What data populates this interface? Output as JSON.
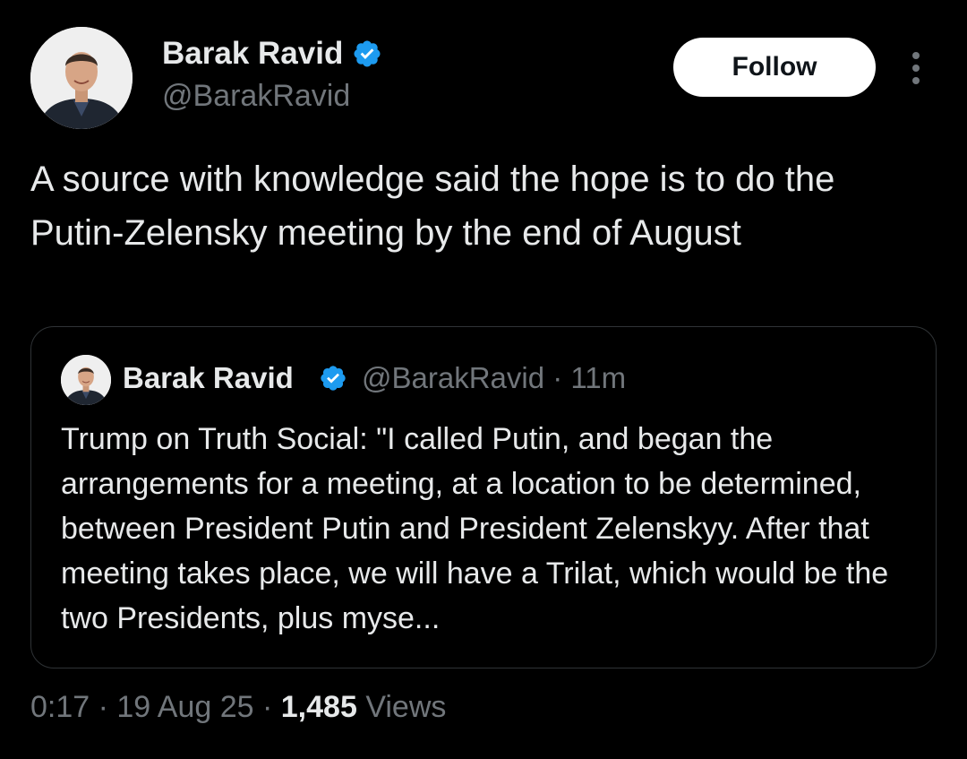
{
  "author": {
    "display_name": "Barak Ravid",
    "handle": "@BarakRavid",
    "verified_icon": "verified-badge-icon",
    "verified_color": "#1d9bf0"
  },
  "actions": {
    "follow_label": "Follow",
    "more_icon": "more-vertical-icon"
  },
  "tweet": {
    "text": "A source with knowledge said the hope is to do the Putin-Zelensky meeting by the end of August"
  },
  "quoted_tweet": {
    "display_name": "Barak Ravid",
    "handle_time": "@BarakRavid · 11m",
    "text": "Trump on Truth Social: \"I called Putin, and began the arrangements for a meeting, at a location to be determined, between President Putin and President Zelenskyy. After that meeting takes place, we will have a Trilat, which would be the two Presidents, plus myse..."
  },
  "footer": {
    "time_date": "0:17 · 19 Aug 25 · ",
    "views_count": "1,485",
    "views_label": "Views"
  },
  "colors": {
    "background": "#000000",
    "primary_text": "#e7e9ea",
    "secondary_text": "#71767b",
    "border": "#2f3336",
    "follow_button_bg": "#ffffff"
  }
}
